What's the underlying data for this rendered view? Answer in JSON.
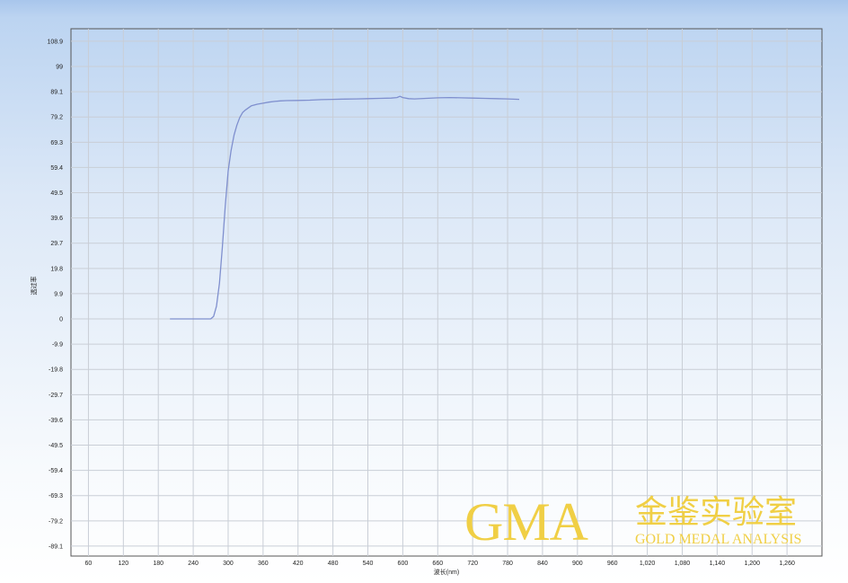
{
  "chart_data": {
    "type": "line",
    "title": "",
    "xlabel": "波长(nm)",
    "ylabel": "透过率",
    "xlim": [
      30,
      1320
    ],
    "ylim": [
      -93,
      113.8
    ],
    "grid": true,
    "x_ticks": [
      "60",
      "120",
      "180",
      "240",
      "300",
      "360",
      "420",
      "480",
      "540",
      "600",
      "660",
      "720",
      "780",
      "840",
      "900",
      "960",
      "1,020",
      "1,080",
      "1,140",
      "1,200",
      "1,260"
    ],
    "y_ticks": [
      "108.9",
      "99",
      "89.1",
      "79.2",
      "69.3",
      "59.4",
      "49.5",
      "39.6",
      "29.7",
      "19.8",
      "9.9",
      "0",
      "-9.9",
      "-19.8",
      "-29.7",
      "-39.6",
      "-49.5",
      "-59.4",
      "-69.3",
      "-79.2",
      "-89.1"
    ],
    "series": [
      {
        "color": "#7f8fce",
        "x": [
          200,
          230,
          260,
          270,
          275,
          280,
          285,
          290,
          295,
          300,
          305,
          310,
          315,
          320,
          325,
          330,
          340,
          350,
          360,
          370,
          380,
          390,
          400,
          420,
          440,
          460,
          480,
          500,
          520,
          540,
          560,
          580,
          590,
          595,
          600,
          610,
          620,
          640,
          660,
          680,
          700,
          720,
          740,
          760,
          780,
          800
        ],
        "y": [
          0,
          0,
          0,
          0,
          1,
          5,
          14,
          28,
          44,
          58,
          66,
          72,
          76,
          79,
          81,
          82,
          83.6,
          84.2,
          84.6,
          85,
          85.3,
          85.5,
          85.6,
          85.7,
          85.8,
          86,
          86.1,
          86.2,
          86.3,
          86.4,
          86.5,
          86.6,
          86.8,
          87.3,
          86.8,
          86.4,
          86.3,
          86.5,
          86.7,
          86.8,
          86.7,
          86.6,
          86.5,
          86.4,
          86.3,
          86.1
        ]
      }
    ]
  },
  "watermark": {
    "logo": "GMA",
    "chinese": "金鉴实验室",
    "english": "GOLD MEDAL ANALYSIS"
  }
}
